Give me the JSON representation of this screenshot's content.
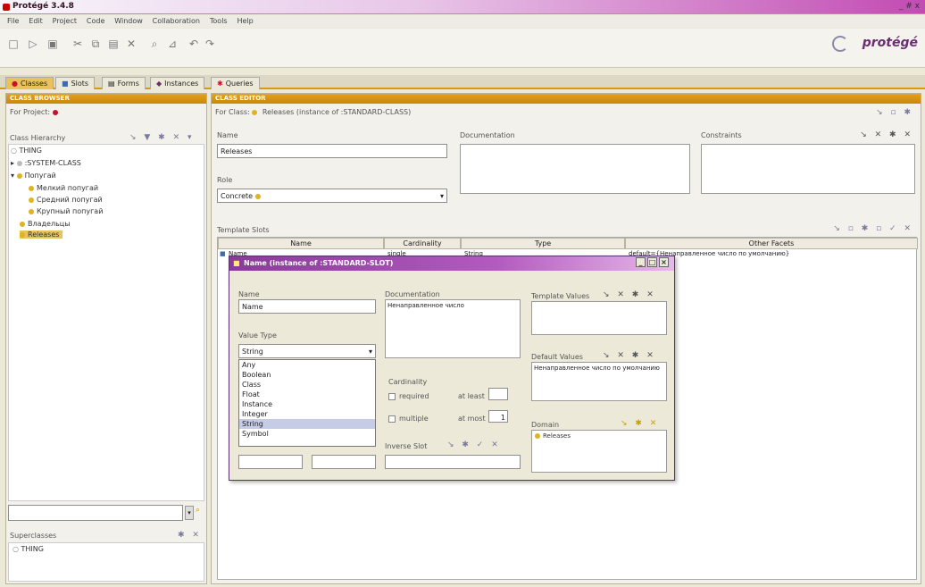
{
  "window": {
    "title": "Protégé 3.4.8",
    "controls": "_ # x"
  },
  "menu": [
    "File",
    "Edit",
    "Project",
    "Code",
    "Window",
    "Collaboration",
    "Tools",
    "Help"
  ],
  "logo": "protégé",
  "tabs": [
    {
      "label": "Classes",
      "icon": "●"
    },
    {
      "label": "Slots",
      "icon": "■"
    },
    {
      "label": "Forms",
      "icon": "▤"
    },
    {
      "label": "Instances",
      "icon": "◆"
    },
    {
      "label": "Queries",
      "icon": "✱"
    }
  ],
  "class_browser": {
    "header": "CLASS BROWSER",
    "for_project": "For Project:",
    "hierarchy_label": "Class Hierarchy",
    "tree": [
      {
        "label": "THING",
        "level": 0
      },
      {
        "label": ":SYSTEM-CLASS",
        "level": 1
      },
      {
        "label": "Попугай",
        "level": 1
      },
      {
        "label": "Мелкий попугай",
        "level": 2
      },
      {
        "label": "Средний попугай",
        "level": 2
      },
      {
        "label": "Крупный попугай",
        "level": 2
      },
      {
        "label": "Владельцы",
        "level": 1
      },
      {
        "label": "Releases",
        "level": 1
      }
    ],
    "superclasses_label": "Superclasses",
    "superclass_item": "THING"
  },
  "class_editor": {
    "header": "CLASS EDITOR",
    "for_class": "For Class:",
    "class_name": "Releases",
    "instance_of": "(instance of :STANDARD-CLASS)",
    "name_label": "Name",
    "name_value": "Releases",
    "role_label": "Role",
    "role_value": "Concrete",
    "doc_label": "Documentation",
    "constraints_label": "Constraints",
    "template_slots_label": "Template Slots",
    "columns": [
      "Name",
      "Cardinality",
      "Type",
      "Other Facets"
    ],
    "rows": [
      {
        "name": "Name",
        "cardinality": "single",
        "type": "String",
        "facets": "default={Ненаправленное число по умолчанию}"
      }
    ]
  },
  "dialog": {
    "title": "Name  (instance of :STANDARD-SLOT)",
    "name_label": "Name",
    "name_value": "Name",
    "doc_label": "Documentation",
    "doc_value": "Ненаправленное число",
    "template_values_label": "Template Values",
    "value_type_label": "Value Type",
    "value_type_value": "String",
    "value_type_options": [
      "Any",
      "Boolean",
      "Class",
      "Float",
      "Instance",
      "Integer",
      "String",
      "Symbol"
    ],
    "default_values_label": "Default Values",
    "default_value": "Ненаправленное число по умолчанию",
    "cardinality_label": "Cardinality",
    "required_label": "required",
    "at_least_label": "at least",
    "multiple_label": "multiple",
    "at_most_label": "at most",
    "at_most_value": "1",
    "inverse_slot_label": "Inverse Slot",
    "domain_label": "Domain",
    "domain_item": "Releases"
  },
  "colors": {
    "accent": "#d69a12",
    "title_purple": "#8a3a9a",
    "logo": "#6b2d72"
  }
}
